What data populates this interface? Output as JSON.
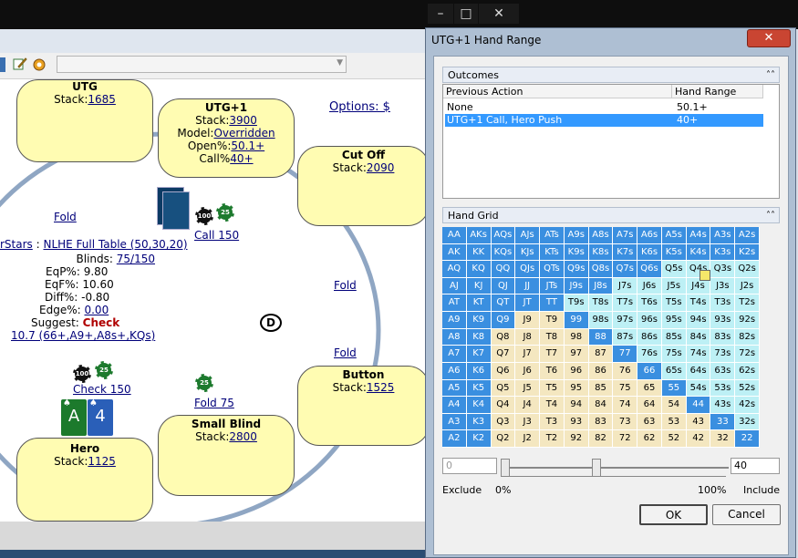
{
  "window": {
    "min_glyph": "–",
    "max_glyph": "□",
    "close_glyph": "✕"
  },
  "seats": [
    {
      "id": "utg",
      "name": "UTG",
      "lines": [
        {
          "label": "Stack:",
          "value": "1685"
        }
      ]
    },
    {
      "id": "utg1",
      "name": "UTG+1",
      "lines": [
        {
          "label": "Stack:",
          "value": "3900"
        },
        {
          "label": "Model:",
          "value": "Overridden"
        },
        {
          "label": "Open%:",
          "value": "50.1+"
        },
        {
          "label": "Call%",
          "value": "40+"
        }
      ]
    },
    {
      "id": "cutoff",
      "name": "Cut Off",
      "lines": [
        {
          "label": "Stack:",
          "value": "2090"
        }
      ]
    },
    {
      "id": "button",
      "name": "Button",
      "lines": [
        {
          "label": "Stack:",
          "value": "1525"
        }
      ]
    },
    {
      "id": "smallblind",
      "name": "Small Blind",
      "lines": [
        {
          "label": "Stack:",
          "value": "2800"
        }
      ]
    },
    {
      "id": "hero",
      "name": "Hero",
      "lines": [
        {
          "label": "Stack:",
          "value": "1125"
        }
      ]
    }
  ],
  "actions": {
    "options": "Options: $",
    "fold_utg": "Fold",
    "call_utg1": "Call 150",
    "fold_co": "Fold",
    "fold_btn": "Fold",
    "fold_sb": "Fold 75",
    "check_hero": "Check 150"
  },
  "chips": {
    "c100": "100",
    "c25": "25"
  },
  "info": {
    "site": "rStars",
    "game": "NLHE Full Table (50,30,20)",
    "rows": [
      {
        "label": "Blinds:",
        "value": "75/150",
        "link": true
      },
      {
        "label": "EqP%:",
        "value": "9.80",
        "link": false
      },
      {
        "label": "EqF%:",
        "value": "10.60",
        "link": false
      },
      {
        "label": "Diff%:",
        "value": "-0.80",
        "link": false
      },
      {
        "label": "Edge%:",
        "value": "0.00",
        "link": true
      }
    ],
    "suggest_label": "Suggest:",
    "suggest_value": "Check",
    "range_text": "10.7 (66+,A9+,A8s+,KQs)"
  },
  "dealer": "D",
  "hero_cards": [
    {
      "rank": "A",
      "suit": "♠"
    },
    {
      "rank": "4",
      "suit": "♠"
    }
  ],
  "dialog": {
    "title": "UTG+1 Hand Range",
    "close_glyph": "✕",
    "outcomes_title": "Outcomes",
    "collapse_glyph": "˄˄",
    "col_prev": "Previous Action",
    "col_range": "Hand Range",
    "outcomes": [
      {
        "action": "None",
        "range": "50.1+",
        "selected": false
      },
      {
        "action": "UTG+1 Call, Hero Push",
        "range": "40+",
        "selected": true
      }
    ],
    "grid_title": "Hand Grid",
    "grid": [
      [
        "AA",
        "AKs",
        "AQs",
        "AJs",
        "ATs",
        "A9s",
        "A8s",
        "A7s",
        "A6s",
        "A5s",
        "A4s",
        "A3s",
        "A2s"
      ],
      [
        "AK",
        "KK",
        "KQs",
        "KJs",
        "KTs",
        "K9s",
        "K8s",
        "K7s",
        "K6s",
        "K5s",
        "K4s",
        "K3s",
        "K2s"
      ],
      [
        "AQ",
        "KQ",
        "QQ",
        "QJs",
        "QTs",
        "Q9s",
        "Q8s",
        "Q7s",
        "Q6s",
        "Q5s",
        "Q4s",
        "Q3s",
        "Q2s"
      ],
      [
        "AJ",
        "KJ",
        "QJ",
        "JJ",
        "JTs",
        "J9s",
        "J8s",
        "J7s",
        "J6s",
        "J5s",
        "J4s",
        "J3s",
        "J2s"
      ],
      [
        "AT",
        "KT",
        "QT",
        "JT",
        "TT",
        "T9s",
        "T8s",
        "T7s",
        "T6s",
        "T5s",
        "T4s",
        "T3s",
        "T2s"
      ],
      [
        "A9",
        "K9",
        "Q9",
        "J9",
        "T9",
        "99",
        "98s",
        "97s",
        "96s",
        "95s",
        "94s",
        "93s",
        "92s"
      ],
      [
        "A8",
        "K8",
        "Q8",
        "J8",
        "T8",
        "98",
        "88",
        "87s",
        "86s",
        "85s",
        "84s",
        "83s",
        "82s"
      ],
      [
        "A7",
        "K7",
        "Q7",
        "J7",
        "T7",
        "97",
        "87",
        "77",
        "76s",
        "75s",
        "74s",
        "73s",
        "72s"
      ],
      [
        "A6",
        "K6",
        "Q6",
        "J6",
        "T6",
        "96",
        "86",
        "76",
        "66",
        "65s",
        "64s",
        "63s",
        "62s"
      ],
      [
        "A5",
        "K5",
        "Q5",
        "J5",
        "T5",
        "95",
        "85",
        "75",
        "65",
        "55",
        "54s",
        "53s",
        "52s"
      ],
      [
        "A4",
        "K4",
        "Q4",
        "J4",
        "T4",
        "94",
        "84",
        "74",
        "64",
        "54",
        "44",
        "43s",
        "42s"
      ],
      [
        "A3",
        "K3",
        "Q3",
        "J3",
        "T3",
        "93",
        "83",
        "73",
        "63",
        "53",
        "43",
        "33",
        "32s"
      ],
      [
        "A2",
        "K2",
        "Q2",
        "J2",
        "T2",
        "92",
        "82",
        "72",
        "62",
        "52",
        "42",
        "32",
        "22"
      ]
    ],
    "grid_colors": {
      "blue": "#3a8fe0",
      "cyan": "#bdf0f5",
      "tan": "#f4e7c0"
    },
    "exclude_value": "0",
    "include_value": "40",
    "exclude_label": "Exclude",
    "pct_0": "0%",
    "pct_100": "100%",
    "include_label": "Include",
    "ok": "OK",
    "cancel": "Cancel"
  }
}
